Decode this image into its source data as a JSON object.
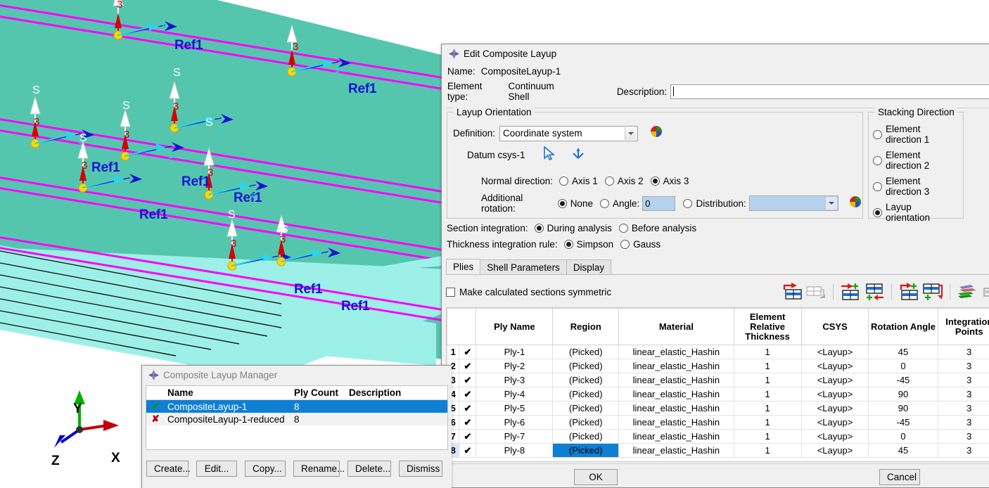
{
  "viewport": {
    "ref_labels": [
      "Ref1",
      "Ref1",
      "Ref1",
      "Ref1",
      "Ref1",
      "Ref1",
      "Ref1",
      "Ref1"
    ],
    "axis_1_label": "1",
    "axis_3_label": "3",
    "section_point_label": "S",
    "triad": {
      "x": "X",
      "y": "Y",
      "z": "Z"
    },
    "colors": {
      "surface": "#55c6ae",
      "edge_surface": "#9df0e8",
      "ply_boundary": "#ff00ff",
      "ref_text": "#1414d2",
      "axis1": "#27d7e8",
      "axis3": "#d40000",
      "background": "#ffffff"
    }
  },
  "edit_dialog": {
    "title": "Edit Composite Layup",
    "icon": "abaqus-diamond-icon",
    "name_label": "Name:",
    "name_value": "CompositeLayup-1",
    "element_type_label": "Element type:",
    "element_type_value": "Continuum Shell",
    "description_label": "Description:",
    "description_value": "",
    "layup_orientation": {
      "title": "Layup Orientation",
      "definition_label": "Definition:",
      "definition_value": "Coordinate system",
      "definition_options": [
        "Coordinate system"
      ],
      "datum_label": "Datum csys-1",
      "pick_icon": "arrow-cursor-icon",
      "csys_icon": "csys-triad-icon",
      "color_wheel_icon": "color-wheel-icon",
      "normal_direction_label": "Normal direction:",
      "normal_direction_options": [
        "Axis 1",
        "Axis 2",
        "Axis 3"
      ],
      "normal_direction_selected": "Axis 3",
      "additional_rotation_label": "Additional rotation:",
      "additional_rotation_options": [
        "None",
        "Angle:",
        "Distribution:"
      ],
      "additional_rotation_selected": "None",
      "angle_value": "0",
      "distribution_value": ""
    },
    "stacking_direction": {
      "title": "Stacking Direction",
      "options": [
        "Element direction 1",
        "Element direction 2",
        "Element direction 3",
        "Layup orientation"
      ],
      "selected": "Layup orientation"
    },
    "section_integration_label": "Section integration:",
    "section_integration_options": [
      "During analysis",
      "Before analysis"
    ],
    "section_integration_selected": "During analysis",
    "thickness_rule_label": "Thickness integration rule:",
    "thickness_rule_options": [
      "Simpson",
      "Gauss"
    ],
    "thickness_rule_selected": "Simpson",
    "tabs": [
      {
        "label": "Plies",
        "active": true
      },
      {
        "label": "Shell Parameters",
        "active": false
      },
      {
        "label": "Display",
        "active": false
      }
    ],
    "symmetric_checkbox_label": "Make calculated sections symmetric",
    "symmetric_checked": false,
    "toolbar_icons": [
      "insert-row-before-icon",
      "move-row-icon",
      "add-row-before-icon",
      "add-row-after-icon",
      "duplicate-row-before-icon",
      "duplicate-row-after-icon",
      "ply-stack-plot-icon",
      "delete-row-icon"
    ],
    "table": {
      "columns": [
        "",
        "",
        "Ply Name",
        "Region",
        "Material",
        "Element Relative Thickness",
        "CSYS",
        "Rotation Angle",
        "Integration Points"
      ],
      "rows": [
        {
          "index": "1",
          "check": "✔",
          "ply_name": "Ply-1",
          "region": "(Picked)",
          "material": "linear_elastic_Hashin",
          "thickness": "1",
          "csys": "<Layup>",
          "rotation": "45",
          "points": "3",
          "selected": false
        },
        {
          "index": "2",
          "check": "✔",
          "ply_name": "Ply-2",
          "region": "(Picked)",
          "material": "linear_elastic_Hashin",
          "thickness": "1",
          "csys": "<Layup>",
          "rotation": "0",
          "points": "3",
          "selected": false
        },
        {
          "index": "3",
          "check": "✔",
          "ply_name": "Ply-3",
          "region": "(Picked)",
          "material": "linear_elastic_Hashin",
          "thickness": "1",
          "csys": "<Layup>",
          "rotation": "-45",
          "points": "3",
          "selected": false
        },
        {
          "index": "4",
          "check": "✔",
          "ply_name": "Ply-4",
          "region": "(Picked)",
          "material": "linear_elastic_Hashin",
          "thickness": "1",
          "csys": "<Layup>",
          "rotation": "90",
          "points": "3",
          "selected": false
        },
        {
          "index": "5",
          "check": "✔",
          "ply_name": "Ply-5",
          "region": "(Picked)",
          "material": "linear_elastic_Hashin",
          "thickness": "1",
          "csys": "<Layup>",
          "rotation": "90",
          "points": "3",
          "selected": false
        },
        {
          "index": "6",
          "check": "✔",
          "ply_name": "Ply-6",
          "region": "(Picked)",
          "material": "linear_elastic_Hashin",
          "thickness": "1",
          "csys": "<Layup>",
          "rotation": "-45",
          "points": "3",
          "selected": false
        },
        {
          "index": "7",
          "check": "✔",
          "ply_name": "Ply-7",
          "region": "(Picked)",
          "material": "linear_elastic_Hashin",
          "thickness": "1",
          "csys": "<Layup>",
          "rotation": "0",
          "points": "3",
          "selected": false
        },
        {
          "index": "8",
          "check": "✔",
          "ply_name": "Ply-8",
          "region": "(Picked)",
          "material": "linear_elastic_Hashin",
          "thickness": "1",
          "csys": "<Layup>",
          "rotation": "45",
          "points": "3",
          "selected": true
        }
      ]
    },
    "ok_label": "OK",
    "cancel_label": "Cancel"
  },
  "manager_dialog": {
    "title": "Composite Layup Manager",
    "icon": "abaqus-diamond-icon",
    "columns": [
      "Name",
      "Ply Count",
      "Description"
    ],
    "rows": [
      {
        "status": "✔",
        "status_color": "#1a8a1a",
        "name": "CompositeLayup-1",
        "ply_count": "8",
        "description": "",
        "selected": true
      },
      {
        "status": "✘",
        "status_color": "#b00000",
        "name": "CompositeLayup-1-reduced",
        "ply_count": "8",
        "description": "",
        "selected": false
      }
    ],
    "buttons": [
      "Create...",
      "Edit...",
      "Copy...",
      "Rename...",
      "Delete...",
      "Dismiss"
    ]
  }
}
